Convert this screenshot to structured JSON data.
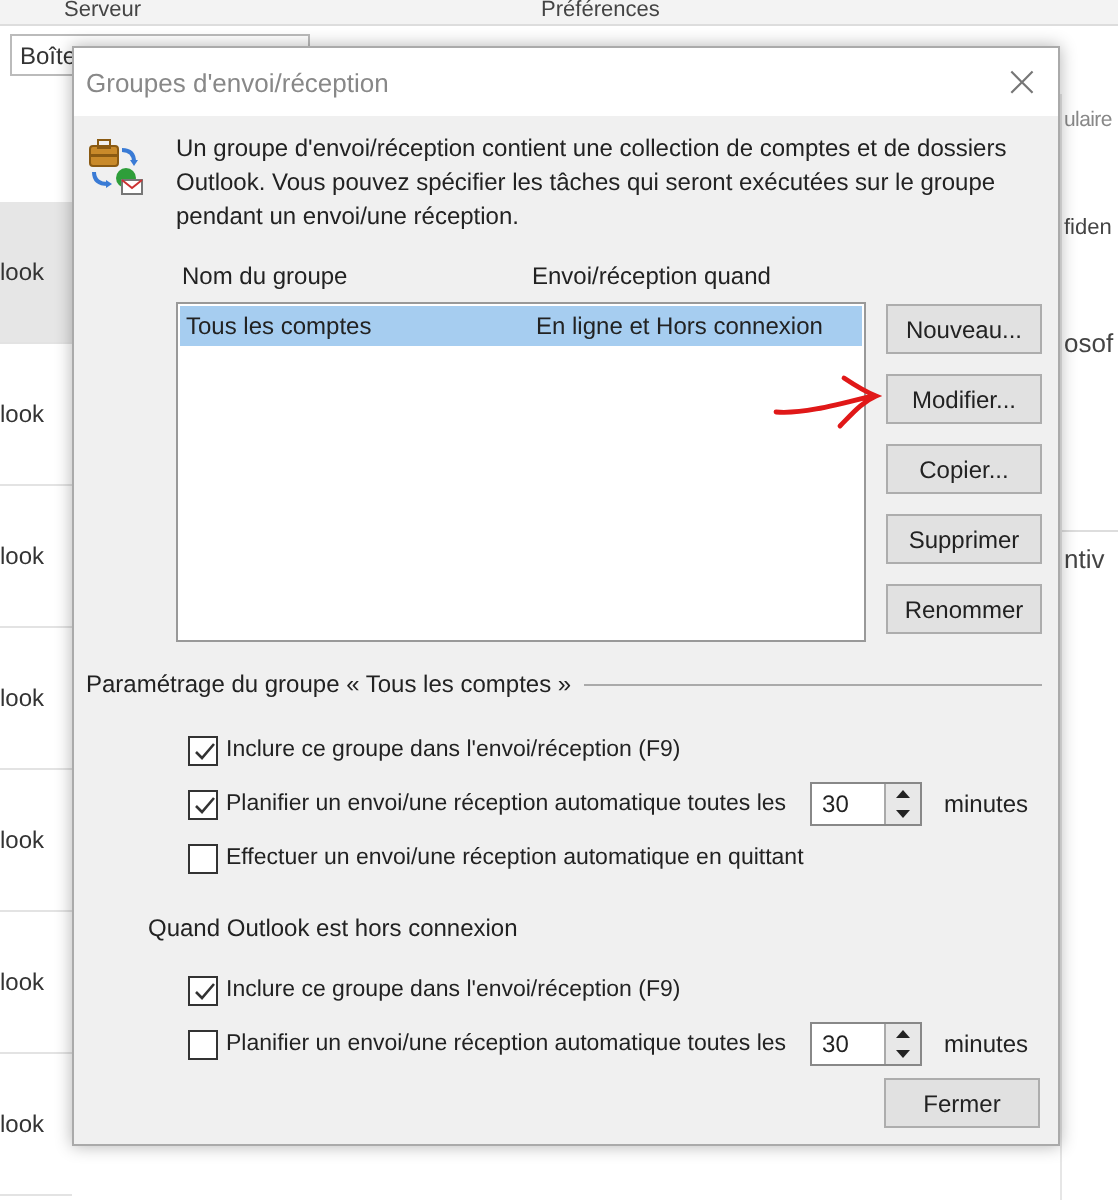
{
  "background": {
    "ribbon_labels": [
      "Serveur",
      "Préférences"
    ],
    "folder_field": "Boîte",
    "list_items": [
      {
        "text": "look",
        "selected": true
      },
      {
        "text": "look",
        "selected": false
      },
      {
        "text": "look",
        "selected": false
      },
      {
        "text": "look",
        "selected": false
      },
      {
        "text": "look",
        "selected": false
      },
      {
        "text": "look",
        "selected": false
      },
      {
        "text": "look",
        "selected": false
      }
    ],
    "right_fragments": [
      "ulaire",
      "fiden",
      "osof",
      "ntiv"
    ]
  },
  "dialog": {
    "title": "Groupes d'envoi/réception",
    "close": "×",
    "description": "Un groupe d'envoi/réception contient une collection de comptes et de dossiers Outlook. Vous pouvez spécifier les tâches qui seront exécutées sur le groupe pendant un envoi/une réception.",
    "columns": [
      "Nom du groupe",
      "Envoi/réception quand"
    ],
    "rows": [
      {
        "name": "Tous les comptes",
        "when": "En ligne et Hors connexion",
        "selected": true
      }
    ],
    "buttons": [
      "Nouveau...",
      "Modifier...",
      "Copier...",
      "Supprimer",
      "Renommer"
    ],
    "group_heading": "Paramétrage du groupe « Tous les comptes »",
    "online_options": [
      {
        "kind": "checkbox",
        "label": "Inclure ce groupe dans l'envoi/réception (F9)",
        "checked": true
      },
      {
        "kind": "schedule",
        "label": "Planifier un envoi/une réception automatique toutes les",
        "checked": true,
        "value": "30",
        "unit": "minutes"
      },
      {
        "kind": "checkbox",
        "label": "Effectuer un envoi/une réception automatique en quittant",
        "checked": false
      }
    ],
    "offline_heading": "Quand Outlook est hors connexion",
    "offline_options": [
      {
        "kind": "checkbox",
        "label": "Inclure ce groupe dans l'envoi/réception (F9)",
        "checked": true
      },
      {
        "kind": "schedule",
        "label": "Planifier un envoi/une réception automatique toutes les",
        "checked": false,
        "value": "30",
        "unit": "minutes"
      }
    ],
    "close_button": "Fermer"
  }
}
